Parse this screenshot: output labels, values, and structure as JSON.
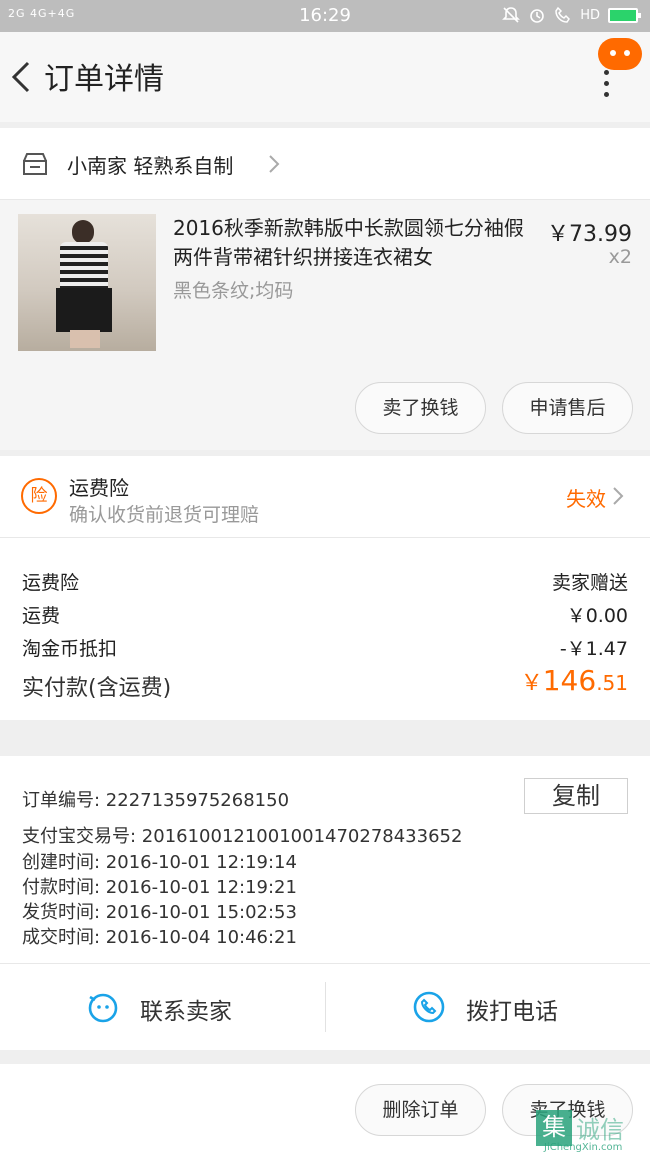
{
  "status_bar": {
    "signal_text": "2G  4G+4G",
    "time": "16:29",
    "hd_text": "HD"
  },
  "nav": {
    "title": "订单详情"
  },
  "shop": {
    "name": "小南家 轻熟系自制"
  },
  "item": {
    "title": "2016秋季新款韩版中长款圆领七分袖假两件背带裙针织拼接连衣裙女",
    "sku": "黑色条纹;均码",
    "price": "￥73.99",
    "qty": "x2",
    "sell_label": "卖了换钱",
    "after_sale_label": "申请售后"
  },
  "insurance": {
    "icon_text": "险",
    "title": "运费险",
    "desc": "确认收货前退货可理赔",
    "status": "失效"
  },
  "fees": {
    "rows": [
      {
        "label": "运费险",
        "value": "卖家赠送"
      },
      {
        "label": "运费",
        "value": "￥0.00"
      },
      {
        "label": "淘金币抵扣",
        "value": "-￥1.47"
      }
    ],
    "total_label": "实付款(含运费)",
    "total_currency": "￥",
    "total_int": "146",
    "total_dec": ".51"
  },
  "order_info": {
    "order_no": "订单编号:   2227135975268150",
    "alipay_no": "支付宝交易号:   2016100121001001470278433652",
    "created": "创建时间:   2016-10-01  12:19:14",
    "paid": "付款时间:   2016-10-01  12:19:21",
    "shipped": "发货时间:   2016-10-01  15:02:53",
    "closed": "成交时间:   2016-10-04  10:46:21",
    "copy_label": "复制"
  },
  "contact": {
    "seller_label": "联系卖家",
    "phone_label": "拨打电话"
  },
  "bottom": {
    "delete_label": "删除订单",
    "sell_label": "卖了换钱"
  },
  "watermark": {
    "logo_char": "集",
    "word": "诚信",
    "url": "JiChengXin.com"
  },
  "colors": {
    "accent": "#ff6a00",
    "contact_icon": "#1aa3e8"
  }
}
